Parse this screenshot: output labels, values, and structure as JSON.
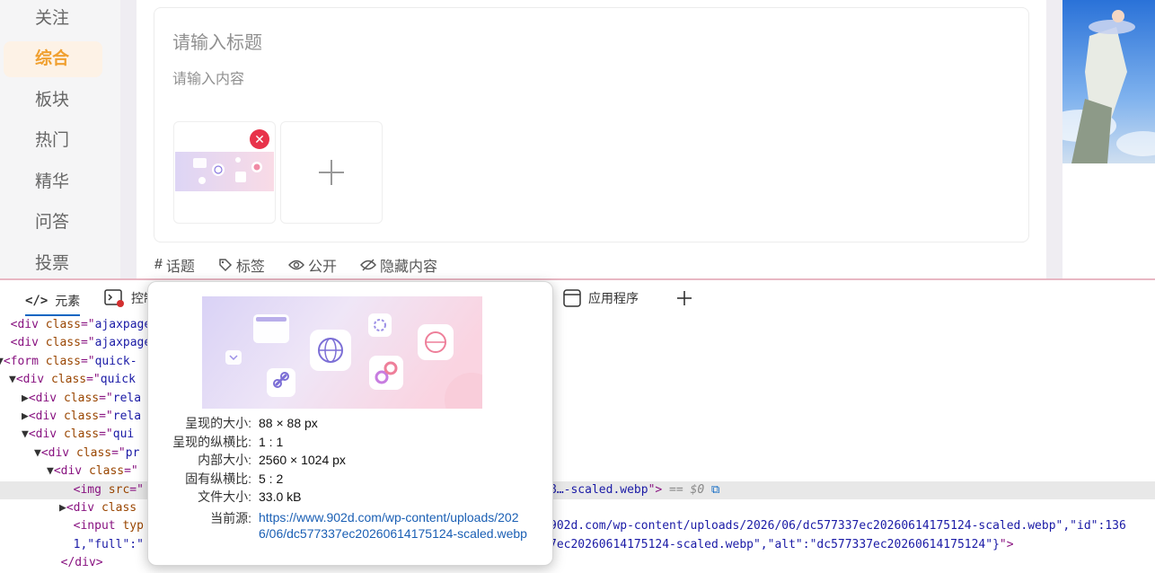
{
  "sidebar": {
    "items": [
      {
        "label": "关注",
        "active": false
      },
      {
        "label": "综合",
        "active": true
      },
      {
        "label": "板块",
        "active": false
      },
      {
        "label": "热门",
        "active": false
      },
      {
        "label": "精华",
        "active": false
      },
      {
        "label": "问答",
        "active": false
      },
      {
        "label": "投票",
        "active": false
      }
    ]
  },
  "editor": {
    "title_placeholder": "请输入标题",
    "content_placeholder": "请输入内容"
  },
  "editor_toolbar": {
    "topic": "话题",
    "tag": "标签",
    "public": "公开",
    "hidden_content": "隐藏内容"
  },
  "devtools": {
    "tabs": {
      "elements": "元素",
      "console": "控制",
      "application": "应用程序"
    },
    "code_lines": [
      {
        "indent": 0,
        "arrow": "",
        "parts": [
          [
            "tag",
            "<div "
          ],
          [
            "attr",
            "class"
          ],
          [
            "tag",
            "=\""
          ],
          [
            "val",
            "ajaxpager"
          ]
        ]
      },
      {
        "indent": 0,
        "arrow": "",
        "parts": [
          [
            "tag",
            "<div "
          ],
          [
            "attr",
            "class"
          ],
          [
            "tag",
            "=\""
          ],
          [
            "val",
            "ajaxpager"
          ]
        ]
      },
      {
        "indent": 0,
        "arrow": "▼",
        "parts": [
          [
            "tag",
            "<form "
          ],
          [
            "attr",
            "class"
          ],
          [
            "tag",
            "=\""
          ],
          [
            "val",
            "quick-"
          ]
        ]
      },
      {
        "indent": 1,
        "arrow": "▼",
        "parts": [
          [
            "tag",
            "<div "
          ],
          [
            "attr",
            "class"
          ],
          [
            "tag",
            "=\""
          ],
          [
            "val",
            "quick"
          ]
        ]
      },
      {
        "indent": 2,
        "arrow": "▶",
        "parts": [
          [
            "tag",
            "<div "
          ],
          [
            "attr",
            "class"
          ],
          [
            "tag",
            "=\""
          ],
          [
            "val",
            "rela"
          ]
        ]
      },
      {
        "indent": 2,
        "arrow": "▶",
        "parts": [
          [
            "tag",
            "<div "
          ],
          [
            "attr",
            "class"
          ],
          [
            "tag",
            "=\""
          ],
          [
            "val",
            "rela"
          ]
        ]
      },
      {
        "indent": 2,
        "arrow": "▼",
        "parts": [
          [
            "tag",
            "<div "
          ],
          [
            "attr",
            "class"
          ],
          [
            "tag",
            "=\""
          ],
          [
            "val",
            "qui"
          ]
        ]
      },
      {
        "indent": 3,
        "arrow": "▼",
        "parts": [
          [
            "tag",
            "<div "
          ],
          [
            "attr",
            "class"
          ],
          [
            "tag",
            "=\""
          ],
          [
            "val",
            "pr"
          ]
        ]
      },
      {
        "indent": 4,
        "arrow": "▼",
        "parts": [
          [
            "tag",
            "<div "
          ],
          [
            "attr",
            "class"
          ],
          [
            "tag",
            "=\""
          ]
        ]
      },
      {
        "indent": 5,
        "arrow": "",
        "parts": [
          [
            "tag",
            "<img "
          ],
          [
            "attr",
            "src"
          ],
          [
            "tag",
            "=\""
          ]
        ],
        "tail": [
          [
            "val",
            "8…-scaled.webp"
          ],
          [
            "tag",
            "\">"
          ],
          [
            "muted",
            " == $0"
          ]
        ]
      },
      {
        "indent": 5,
        "arrow": "▶",
        "parts": [
          [
            "tag",
            "<div "
          ],
          [
            "attr",
            "class"
          ]
        ]
      },
      {
        "indent": 5,
        "arrow": "",
        "parts": [
          [
            "tag",
            "<input "
          ],
          [
            "attr",
            "typ"
          ]
        ],
        "tail": [
          [
            "val",
            "902d.com/wp-content/uploads/2026/06/dc577337ec20260614175124-scaled.webp"
          ],
          [
            "val",
            "\",\"id\":136"
          ]
        ]
      },
      {
        "indent": 5,
        "arrow": "",
        "parts": [
          [
            "val",
            "1,\"full\":\""
          ]
        ],
        "tail": [
          [
            "val",
            "7ec20260614175124-scaled.webp\",\"alt\":\"dc577337ec20260614175124\"}"
          ],
          [
            "tag",
            "\">"
          ]
        ]
      },
      {
        "indent": 4,
        "arrow": "",
        "parts": [
          [
            "tag",
            "</div>"
          ]
        ]
      }
    ]
  },
  "image_popup": {
    "rows": [
      {
        "label": "呈现的大小:",
        "value": "88 × 88 px"
      },
      {
        "label": "呈现的纵横比:",
        "value": "1 : 1"
      },
      {
        "label": "内部大小:",
        "value": "2560 × 1024 px"
      },
      {
        "label": "固有纵横比:",
        "value": "5 : 2"
      },
      {
        "label": "文件大小:",
        "value": "33.0 kB"
      }
    ],
    "source_label": "当前源:",
    "source_url": "https://www.902d.com/wp-content/uploads/2026/06/dc577337ec20260614175124-scaled.webp"
  },
  "colors": {
    "accent_orange": "#f0a030",
    "delete_red": "#e8334a",
    "devtools_blue": "#0a66c2",
    "link_blue": "#1a5fb4"
  }
}
